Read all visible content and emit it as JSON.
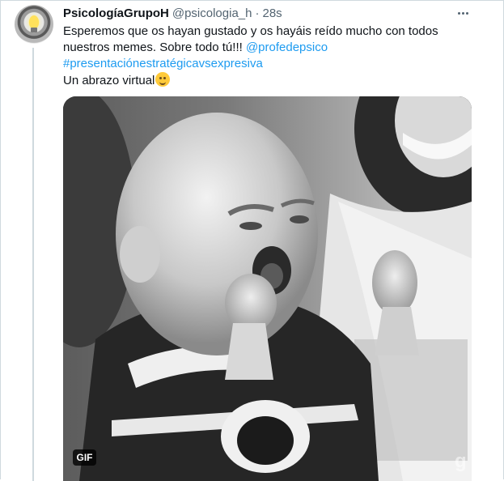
{
  "tweet": {
    "author_name": "PsicologíaGrupoH",
    "author_handle": "@psicologia_h",
    "separator": "·",
    "timestamp": "28s",
    "text_line1": "Esperemos que os hayan gustado y os hayáis reído mucho con todos",
    "text_line2_prefix": "nuestros memes. Sobre todo tú!!! ",
    "mention": "@profedepsico",
    "hashtag": "#presentaciónestratégicavsexpresiva",
    "text_line4": "Un abrazo virtual",
    "emoji_icon": "smiling-face-emoji",
    "media": {
      "badge": "GIF",
      "watermark": "g"
    }
  },
  "colors": {
    "link": "#1d9bf0",
    "text": "#0f1419",
    "secondary": "#536471",
    "border": "#cfd9de"
  }
}
